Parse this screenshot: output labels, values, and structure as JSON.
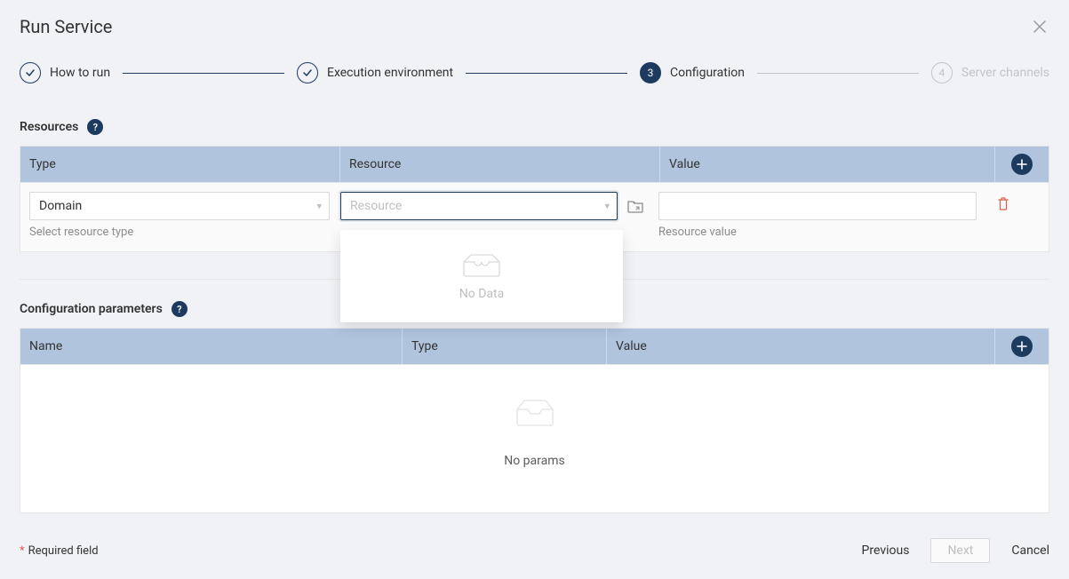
{
  "modal": {
    "title": "Run Service"
  },
  "stepper": {
    "steps": [
      {
        "label": "How to run",
        "state": "done"
      },
      {
        "label": "Execution environment",
        "state": "done"
      },
      {
        "label": "Configuration",
        "state": "active",
        "number": "3"
      },
      {
        "label": "Server channels",
        "state": "pending",
        "number": "4"
      }
    ]
  },
  "resources": {
    "title": "Resources",
    "columns": {
      "type": "Type",
      "resource": "Resource",
      "value": "Value"
    },
    "row": {
      "type_value": "Domain",
      "type_hint": "Select resource type",
      "resource_placeholder": "Resource",
      "value_hint": "Resource value"
    },
    "dropdown_empty": "No Data"
  },
  "config_params": {
    "title": "Configuration parameters",
    "columns": {
      "name": "Name",
      "type": "Type",
      "value": "Value"
    },
    "empty": "No params"
  },
  "footer": {
    "required": "Required field",
    "prev": "Previous",
    "next": "Next",
    "cancel": "Cancel"
  }
}
